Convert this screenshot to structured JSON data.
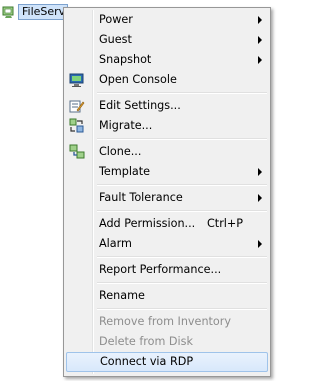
{
  "tree": {
    "selected_item": "FileServ"
  },
  "menu": {
    "power": "Power",
    "guest": "Guest",
    "snapshot": "Snapshot",
    "open_console": "Open Console",
    "edit_settings": "Edit Settings...",
    "migrate": "Migrate...",
    "clone": "Clone...",
    "template": "Template",
    "fault_tolerance": "Fault Tolerance",
    "add_permission": "Add Permission...",
    "add_permission_shortcut": "Ctrl+P",
    "alarm": "Alarm",
    "report_performance": "Report Performance...",
    "rename": "Rename",
    "remove_from_inventory": "Remove from Inventory",
    "delete_from_disk": "Delete from Disk",
    "connect_via_rdp": "Connect via RDP"
  },
  "colors": {
    "menu_background": "#f0f0f0",
    "highlight": "#d8e8fb",
    "highlight_border": "#9fc3ea",
    "disabled_text": "#8d8d8d"
  }
}
